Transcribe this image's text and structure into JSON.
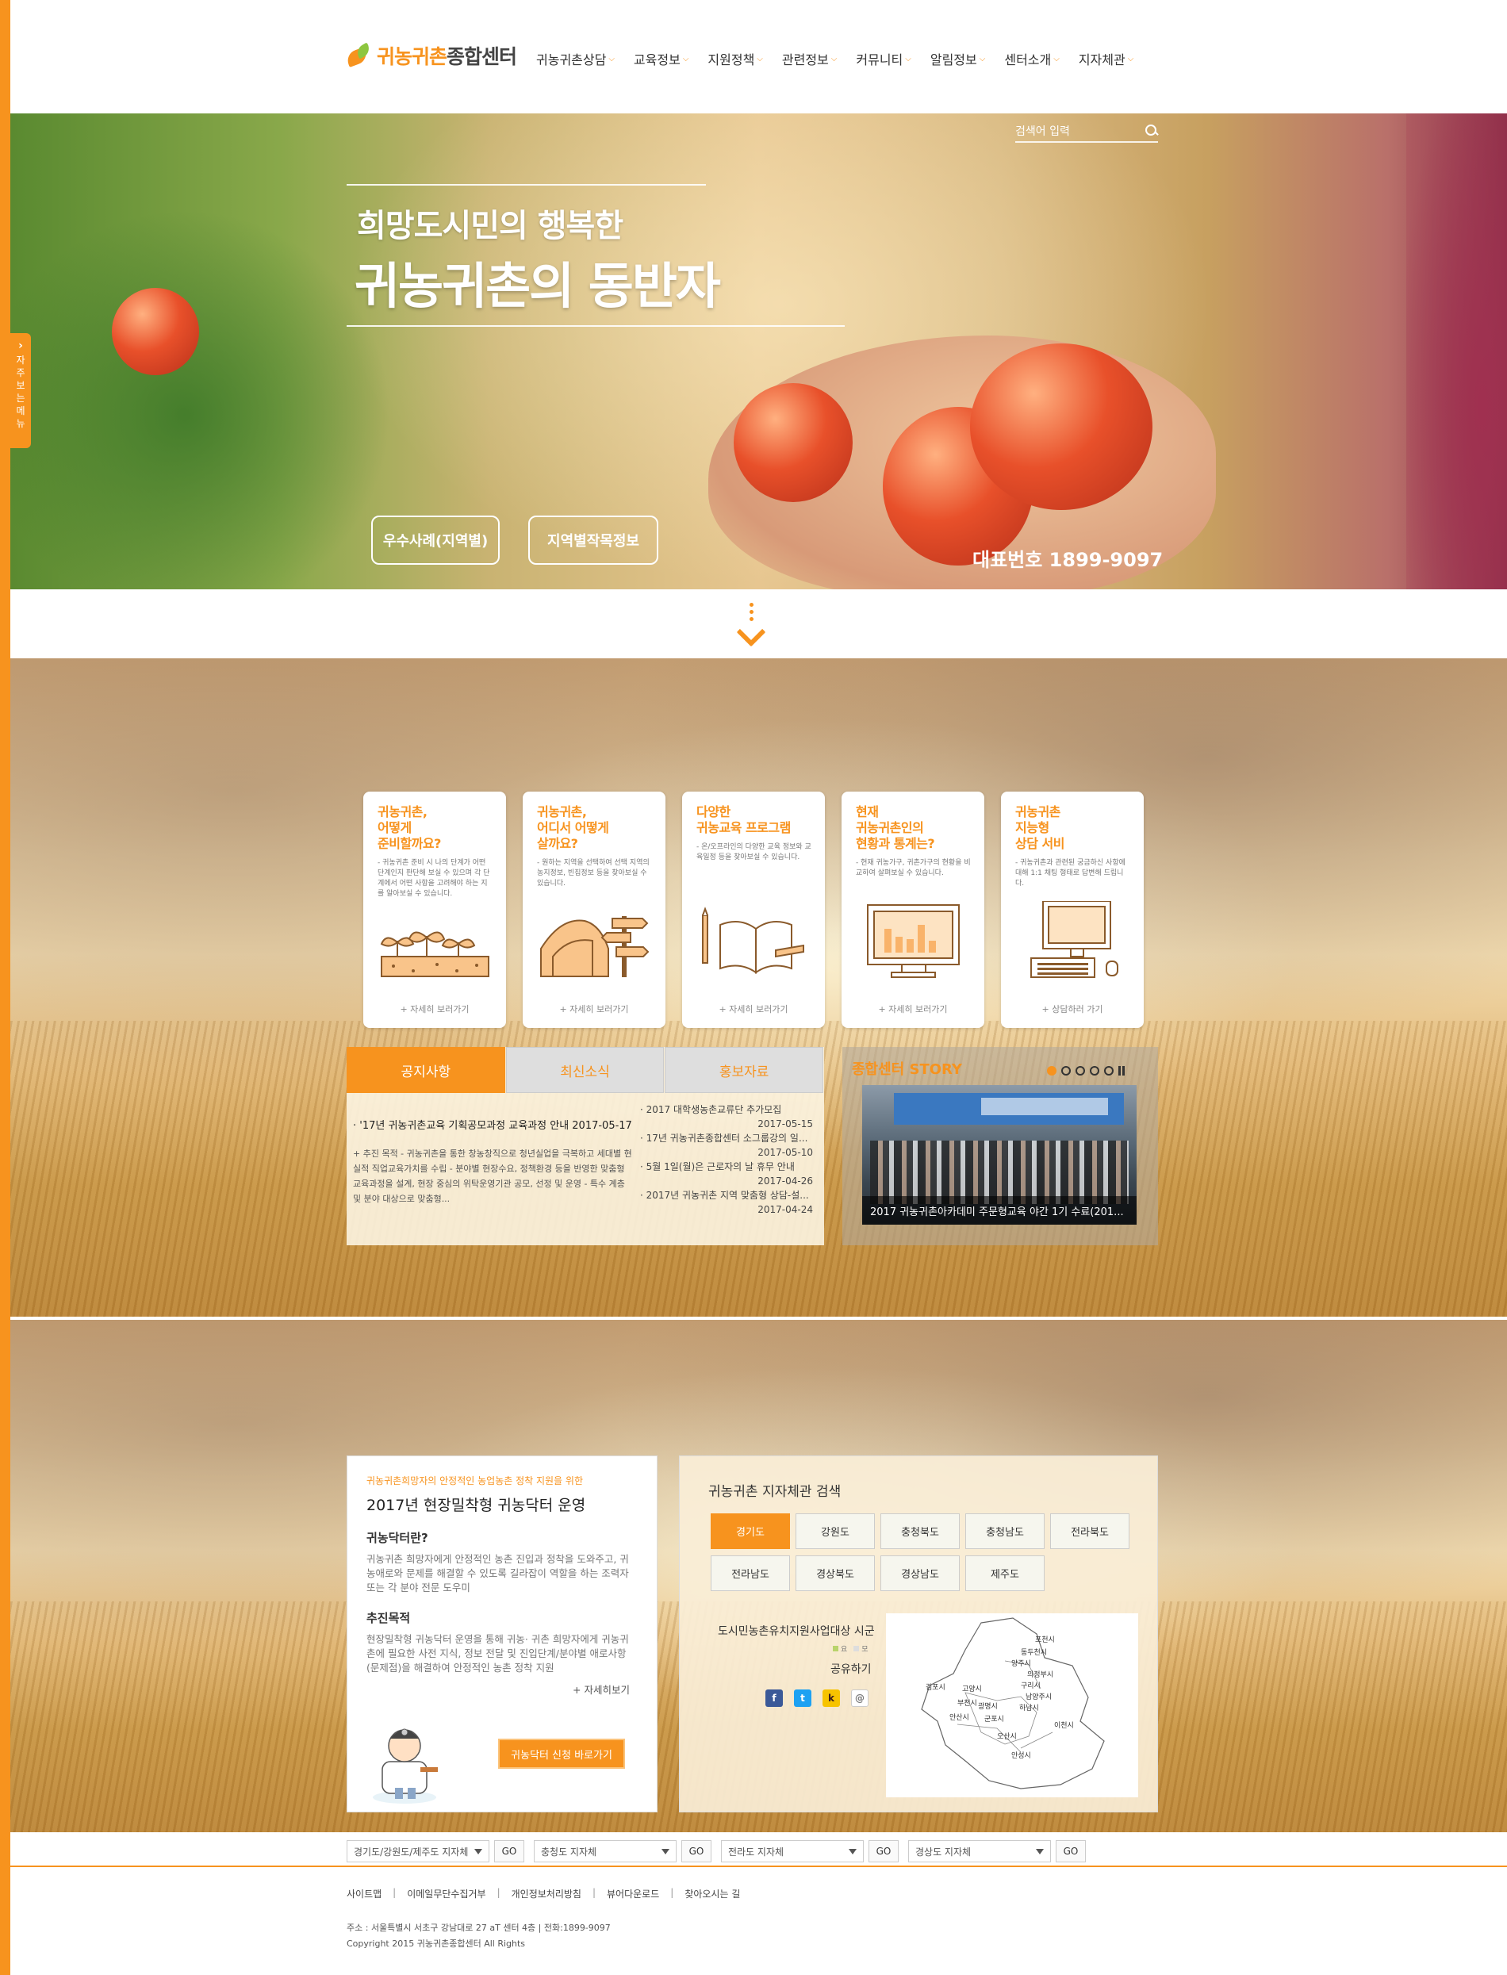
{
  "header": {
    "logo": {
      "part1": "귀농귀촌",
      "part2": "종합센터"
    },
    "nav": [
      "귀농귀촌상담",
      "교육정보",
      "지원정책",
      "관련정보",
      "커뮤니티",
      "알림정보",
      "센터소개",
      "지자체관"
    ]
  },
  "side_menu": {
    "label": "자주보는메뉴"
  },
  "hero": {
    "search_placeholder": "검색어 입력",
    "subtitle": "희망도시민의 행복한",
    "title": "귀농귀촌의 동반자",
    "buttons": [
      "우수사례(지역별)",
      "지역별작목정보"
    ],
    "phone": "대표번호 1899-9097"
  },
  "cards": [
    {
      "title": "귀농귀촌,\n어떻게\n준비할까요?",
      "desc": "- 귀농귀촌 준비 시 나의 단계가 어떤 단계인지 판단해 보실 수 있으며 각 단계에서 어떤 사항을 고려해야 하는 지를 알아보실 수 있습니다.",
      "more": "+ 자세히 보러가기",
      "icon": "sprout-icon"
    },
    {
      "title": "귀농귀촌,\n어디서 어떻게\n살까요?",
      "desc": "- 원하는 지역을 선택하여 선택 지역의 농지정보, 빈집정보 등을 찾아보실 수 있습니다.",
      "more": "+ 자세히 보러가기",
      "icon": "greenhouse-signpost-icon"
    },
    {
      "title": "다양한\n귀농교육 프로그램",
      "desc": "- 온/오프라인의 다양한 교육 정보와 교육일정 등을 찾아보실 수 있습니다.",
      "more": "+ 자세히 보러가기",
      "icon": "book-pencil-icon"
    },
    {
      "title": "현재\n귀농귀촌인의\n현황과 통계는?",
      "desc": "- 현재 귀농가구, 귀촌가구의 현황을 비교하여 살펴보실 수 있습니다.",
      "more": "+ 자세히 보러가기",
      "icon": "monitor-chart-icon"
    },
    {
      "title": "귀농귀촌\n지능형\n상담 서비",
      "desc": "- 귀농귀촌과 관련된 궁금하신 사항에 대해 1:1 채팅 형태로 답변해 드립니다.",
      "more": "+ 상담하러 가기",
      "icon": "computer-icon"
    }
  ],
  "notice": {
    "tabs": [
      "공지사항",
      "최신소식",
      "홍보자료"
    ],
    "featured_title": "· '17년 귀농귀촌교육 기획공모과정 교육과정 안내   2017-05-17",
    "featured_desc": "+ 추진 목적  - 귀농귀촌을 통한 창농창직으로 청년실업을 극복하고 세대별 현실적 직업교육가치를 수립  - 분야별 현장수요, 정책환경 등을 반영한 맞춤형 교육과정을 설계, 현장 중심의 위탁운영기관 공모, 선정 및 운영  - 특수 계층 및 분야 대상으로 맞춤형...",
    "items": [
      {
        "title": "· 2017 대학생농촌교류단 추가모집",
        "date": "2017-05-15"
      },
      {
        "title": "· 17년 귀농귀촌종합센터 소그룹강의 일...",
        "date": "2017-05-10"
      },
      {
        "title": "· 5월 1일(월)은 근로자의 날 휴무 안내",
        "date": "2017-04-26"
      },
      {
        "title": "· 2017년 귀농귀촌 지역 맞춤형 상담-설...",
        "date": "2017-04-24"
      }
    ]
  },
  "story": {
    "title": "종합센터 STORY",
    "caption": "2017 귀농귀촌아카데미 주문형교육 야간 1기 수료(201..."
  },
  "doctor": {
    "kicker": "귀농귀촌희망자의 안정적인 농업농촌 정착 지원을 위한",
    "title": "2017년 현장밀착형 귀농닥터 운영",
    "h1": "귀농닥터란?",
    "p1": "귀농귀촌 희망자에게 안정적인 농촌 진입과 정착을 도와주고, 귀농애로와 문제를 해결할 수 있도록 길라잡이 역할을 하는 조력자 또는 각 분야 전문 도우미",
    "h2": "추진목적",
    "p2": "현장밀착형 귀농닥터 운영을 통해 귀농· 귀촌 희망자에게 귀농귀촌에 필요한 사전 지식, 정보 전달 및 진입단계/분야별 애로사항(문제점)을 해결하여 안정적인 농촌 정착 지원",
    "more": "+ 자세히보기",
    "button": "귀농닥터 신청 바로가기"
  },
  "region": {
    "title": "귀농귀촌 지자체관 검색",
    "provinces": [
      "경기도",
      "강원도",
      "충청북도",
      "충청남도",
      "전라북도",
      "전라남도",
      "경상북도",
      "경상남도",
      "제주도"
    ],
    "label": "도시민농촌유치지원사업대상 시군",
    "legend": [
      "요",
      "모"
    ],
    "share": "공유하기",
    "sns": [
      "f",
      "t",
      "k",
      "@"
    ],
    "map_places": [
      "포천시",
      "동두천시",
      "양주시",
      "의정부시",
      "김포시",
      "고양시",
      "구리시",
      "남양주시",
      "부천시",
      "광명시",
      "하남시",
      "안산시",
      "군포시",
      "이천시",
      "오산시",
      "안성시"
    ]
  },
  "footer": {
    "selects": [
      "경기도/강원도/제주도 지자체",
      "충청도 지자체",
      "전라도 지자체",
      "경상도 지자체"
    ],
    "go": "GO",
    "links": [
      "사이트맵",
      "이메일무단수집거부",
      "개인정보처리방침",
      "뷰어다운로드",
      "찾아오시는 길"
    ],
    "address": "주소 : 서울특별시 서초구 강남대로 27 aT 센터 4층    |    전화:1899-9097",
    "copyright": "Copyright 2015 귀농귀촌종합센터 All Rights"
  },
  "colors": {
    "accent": "#f7931e",
    "green": "#8dc63f"
  }
}
